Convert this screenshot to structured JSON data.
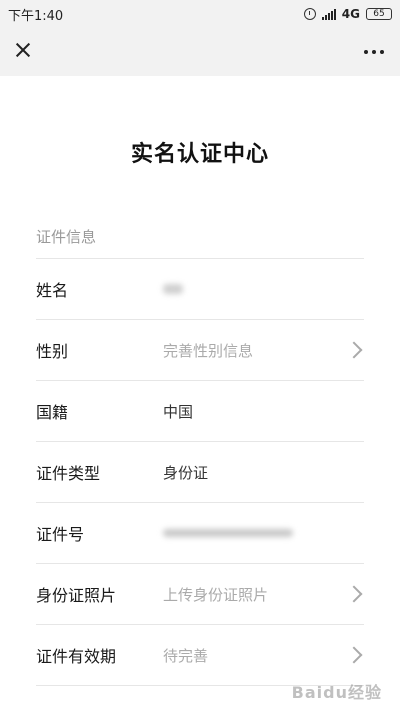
{
  "statusbar": {
    "time": "下午1:40",
    "network": "4G",
    "battery": "65"
  },
  "icons": {
    "close": "close-icon",
    "more": "more-icon",
    "chevron": "chevron-right-icon"
  },
  "page": {
    "title": "实名认证中心"
  },
  "section": {
    "label": "证件信息"
  },
  "rows": [
    {
      "label": "姓名",
      "value": "",
      "type": "blur-short"
    },
    {
      "label": "性别",
      "value": "完善性别信息",
      "type": "placeholder",
      "chevron": true
    },
    {
      "label": "国籍",
      "value": "中国",
      "type": "value"
    },
    {
      "label": "证件类型",
      "value": "身份证",
      "type": "value"
    },
    {
      "label": "证件号",
      "value": "",
      "type": "blur-long"
    },
    {
      "label": "身份证照片",
      "value": "上传身份证照片",
      "type": "placeholder",
      "chevron": true
    },
    {
      "label": "证件有效期",
      "value": "待完善",
      "type": "placeholder",
      "chevron": true
    }
  ],
  "watermark": "Baidu经验"
}
